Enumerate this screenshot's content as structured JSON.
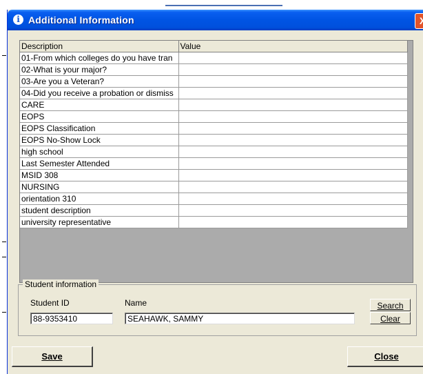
{
  "window": {
    "title": "Additional Information",
    "close_glyph": "X",
    "info_glyph": "i"
  },
  "grid": {
    "columns": [
      "Description",
      "Value"
    ],
    "rows": [
      {
        "description": "01-From which colleges do you have tran",
        "value": ""
      },
      {
        "description": "02-What is your major?",
        "value": ""
      },
      {
        "description": "03-Are you a Veteran?",
        "value": ""
      },
      {
        "description": "04-Did you receive a probation or dismiss",
        "value": ""
      },
      {
        "description": "CARE",
        "value": ""
      },
      {
        "description": "EOPS",
        "value": ""
      },
      {
        "description": "EOPS Classification",
        "value": ""
      },
      {
        "description": "EOPS No-Show Lock",
        "value": ""
      },
      {
        "description": "high school",
        "value": ""
      },
      {
        "description": "Last Semester Attended",
        "value": ""
      },
      {
        "description": "MSID 308",
        "value": ""
      },
      {
        "description": "NURSING",
        "value": ""
      },
      {
        "description": "orientation 310",
        "value": ""
      },
      {
        "description": "student description",
        "value": ""
      },
      {
        "description": "university representative",
        "value": ""
      }
    ]
  },
  "student_info": {
    "group_label": "Student information",
    "student_id_label": "Student ID",
    "student_id_value": "88-9353410",
    "name_label": "Name",
    "name_value": "SEAHAWK, SAMMY",
    "search_label": "Search",
    "clear_label": "Clear"
  },
  "buttons": {
    "save_label": "Save",
    "close_label": "Close"
  },
  "colors": {
    "titlebar": "#0054e3",
    "dialog_bg": "#ece9d8",
    "grid_bg": "#ababab",
    "close_button": "#e2542a"
  }
}
